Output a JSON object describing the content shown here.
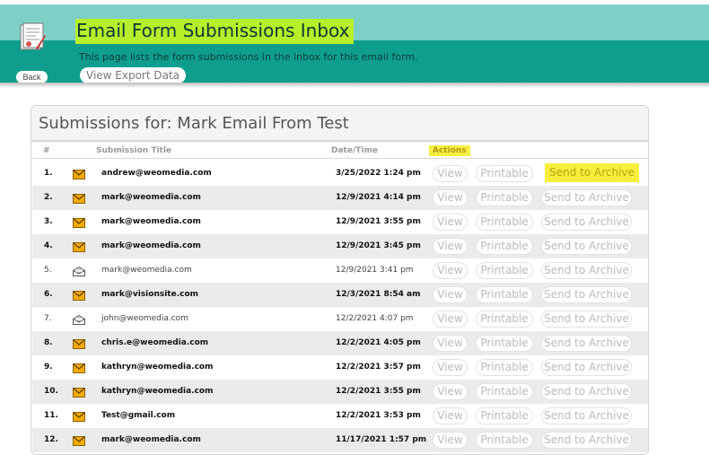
{
  "header": {
    "title": "Email Form Submissions Inbox",
    "subtitle": "This page lists the form submissions in the inbox for this email form.",
    "back_label": "Back",
    "export_label": "View Export Data",
    "icon": "form-document-icon",
    "colors": {
      "band_light": "#7ecfc6",
      "band_dark": "#0f9e8e",
      "highlight": "#b7ef2a"
    }
  },
  "panel": {
    "title": "Submissions for: Mark Email From Test",
    "columns": {
      "num": "#",
      "title": "Submission Title",
      "date": "Date/Time",
      "actions": "Actions"
    }
  },
  "actions": {
    "view": "View",
    "printable": "Printable",
    "archive": "Send to Archive"
  },
  "rows": [
    {
      "num": "1.",
      "title": "andrew@weomedia.com",
      "date": "3/25/2022 1:24 pm",
      "read": false,
      "icon": "envelope-closed-icon"
    },
    {
      "num": "2.",
      "title": "mark@weomedia.com",
      "date": "12/9/2021 4:14 pm",
      "read": false,
      "icon": "envelope-closed-icon"
    },
    {
      "num": "3.",
      "title": "mark@weomedia.com",
      "date": "12/9/2021 3:55 pm",
      "read": false,
      "icon": "envelope-closed-icon"
    },
    {
      "num": "4.",
      "title": "mark@weomedia.com",
      "date": "12/9/2021 3:45 pm",
      "read": false,
      "icon": "envelope-closed-icon"
    },
    {
      "num": "5.",
      "title": "mark@weomedia.com",
      "date": "12/9/2021 3:41 pm",
      "read": true,
      "icon": "envelope-open-icon"
    },
    {
      "num": "6.",
      "title": "mark@visionsite.com",
      "date": "12/3/2021 8:54 am",
      "read": false,
      "icon": "envelope-closed-icon"
    },
    {
      "num": "7.",
      "title": "john@weomedia.com",
      "date": "12/2/2021 4:07 pm",
      "read": true,
      "icon": "envelope-open-icon"
    },
    {
      "num": "8.",
      "title": "chris.e@weomedia.com",
      "date": "12/2/2021 4:05 pm",
      "read": false,
      "icon": "envelope-closed-icon"
    },
    {
      "num": "9.",
      "title": "kathryn@weomedia.com",
      "date": "12/2/2021 3:57 pm",
      "read": false,
      "icon": "envelope-closed-icon"
    },
    {
      "num": "10.",
      "title": "kathryn@weomedia.com",
      "date": "12/2/2021 3:55 pm",
      "read": false,
      "icon": "envelope-closed-icon"
    },
    {
      "num": "11.",
      "title": "Test@gmail.com",
      "date": "12/2/2021 3:53 pm",
      "read": false,
      "icon": "envelope-closed-icon"
    },
    {
      "num": "12.",
      "title": "mark@weomedia.com",
      "date": "11/17/2021 1:57 pm",
      "read": false,
      "icon": "envelope-closed-icon"
    }
  ]
}
